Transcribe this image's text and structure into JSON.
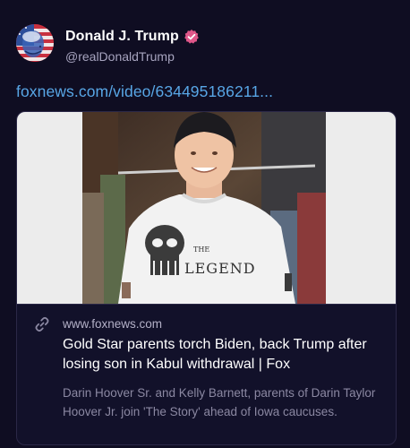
{
  "post": {
    "author": {
      "display_name": "Donald J. Trump",
      "handle": "@realDonaldTrump",
      "verified": true
    },
    "link_text": "foxnews.com/video/634495186211...",
    "link_card": {
      "image_shirt_text": "LEGEND",
      "image_shirt_small_text": "THE",
      "domain": "www.foxnews.com",
      "title": "Gold Star parents torch Biden, back Trump after losing son in Kabul withdrawal | Fox",
      "description": "Darin Hoover Sr. and Kelly Barnett, parents of Darin Taylor Hoover Jr. join 'The Story' ahead of Iowa caucuses."
    }
  },
  "colors": {
    "background": "#0f0d22",
    "link": "#58a6e6",
    "verified_badge": "#e0578a",
    "card_border": "#2b2847",
    "muted_text": "#8b88a2"
  },
  "icons": {
    "verified": "verified-badge-icon",
    "link": "link-chain-icon"
  }
}
